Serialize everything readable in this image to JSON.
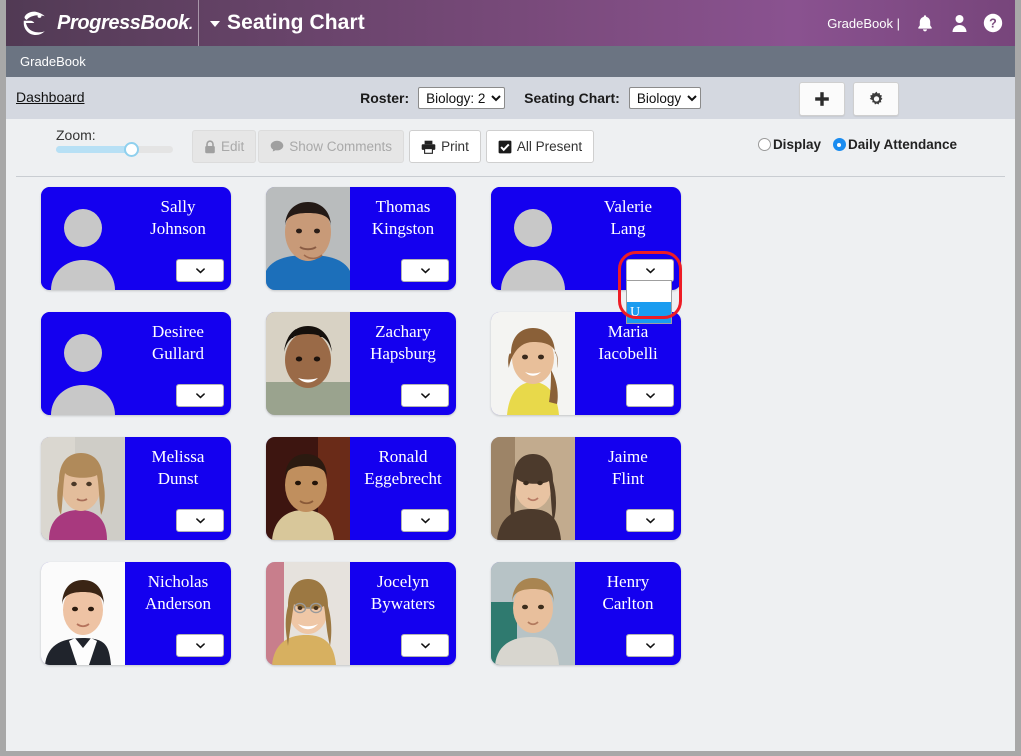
{
  "header": {
    "brand": "ProgressBook",
    "page_title": "Seating Chart",
    "user_text": "GradeBook |",
    "icons": [
      "bell-icon",
      "user-icon",
      "help-icon"
    ]
  },
  "breadcrumb": {
    "text": "GradeBook"
  },
  "selector_bar": {
    "dashboard_link": "Dashboard",
    "roster_label": "Roster:",
    "roster_value": "Biology: 2",
    "roster_options": [
      "Biology: 2"
    ],
    "seating_chart_label": "Seating Chart:",
    "seating_chart_value": "Biology",
    "seating_chart_options": [
      "Biology"
    ],
    "add_button": "+",
    "settings_button": "gear-icon"
  },
  "toolbar": {
    "zoom_label": "Zoom:",
    "zoom_percent": 58,
    "buttons": [
      {
        "label": "Edit",
        "icon": "lock-icon",
        "disabled": true
      },
      {
        "label": "Show Comments",
        "icon": "comment-icon",
        "disabled": true
      },
      {
        "label": "Print",
        "icon": "printer-icon",
        "disabled": false
      },
      {
        "label": "All Present",
        "icon": "checkbox-checked-icon",
        "disabled": false
      }
    ],
    "modes": [
      {
        "label": "Display",
        "selected": false
      },
      {
        "label": "Daily Attendance",
        "selected": true
      }
    ]
  },
  "colors": {
    "header_purple": "#7b4b7d",
    "subbar_grey": "#6b7482",
    "selbar_grey": "#d4d8e0",
    "card_blue": "#1400ef",
    "accent_blue": "#1a8cf0",
    "highlight_red": "#ee1c25"
  },
  "seating": {
    "rows": [
      [
        {
          "first": "Sally",
          "last": "Johnson",
          "photo": "placeholder"
        },
        {
          "first": "Thomas",
          "last": "Kingston",
          "photo": "boy-blue-shirt"
        },
        {
          "first": "Valerie",
          "last": "Lang",
          "photo": "placeholder",
          "dropdown_open": true
        }
      ],
      [
        {
          "first": "Desiree",
          "last": "Gullard",
          "photo": "placeholder"
        },
        {
          "first": "Zachary",
          "last": "Hapsburg",
          "photo": "boy-dark-hair"
        },
        {
          "first": "Maria",
          "last": "Iacobelli",
          "photo": "girl-yellow-jacket"
        }
      ],
      [
        {
          "first": "Melissa",
          "last": "Dunst",
          "photo": "girl-long-hair"
        },
        {
          "first": "Ronald",
          "last": "Eggebrecht",
          "photo": "boy-short-hair"
        },
        {
          "first": "Jaime",
          "last": "Flint",
          "photo": "girl-brown-hair"
        }
      ],
      [
        {
          "first": "Nicholas",
          "last": "Anderson",
          "photo": "boy-suit"
        },
        {
          "first": "Jocelyn",
          "last": "Bywaters",
          "photo": "girl-glasses"
        },
        {
          "first": "Henry",
          "last": "Carlton",
          "photo": "boy-blond"
        }
      ]
    ],
    "dropdown": {
      "options": [
        "",
        "U"
      ],
      "selected": "U"
    }
  }
}
